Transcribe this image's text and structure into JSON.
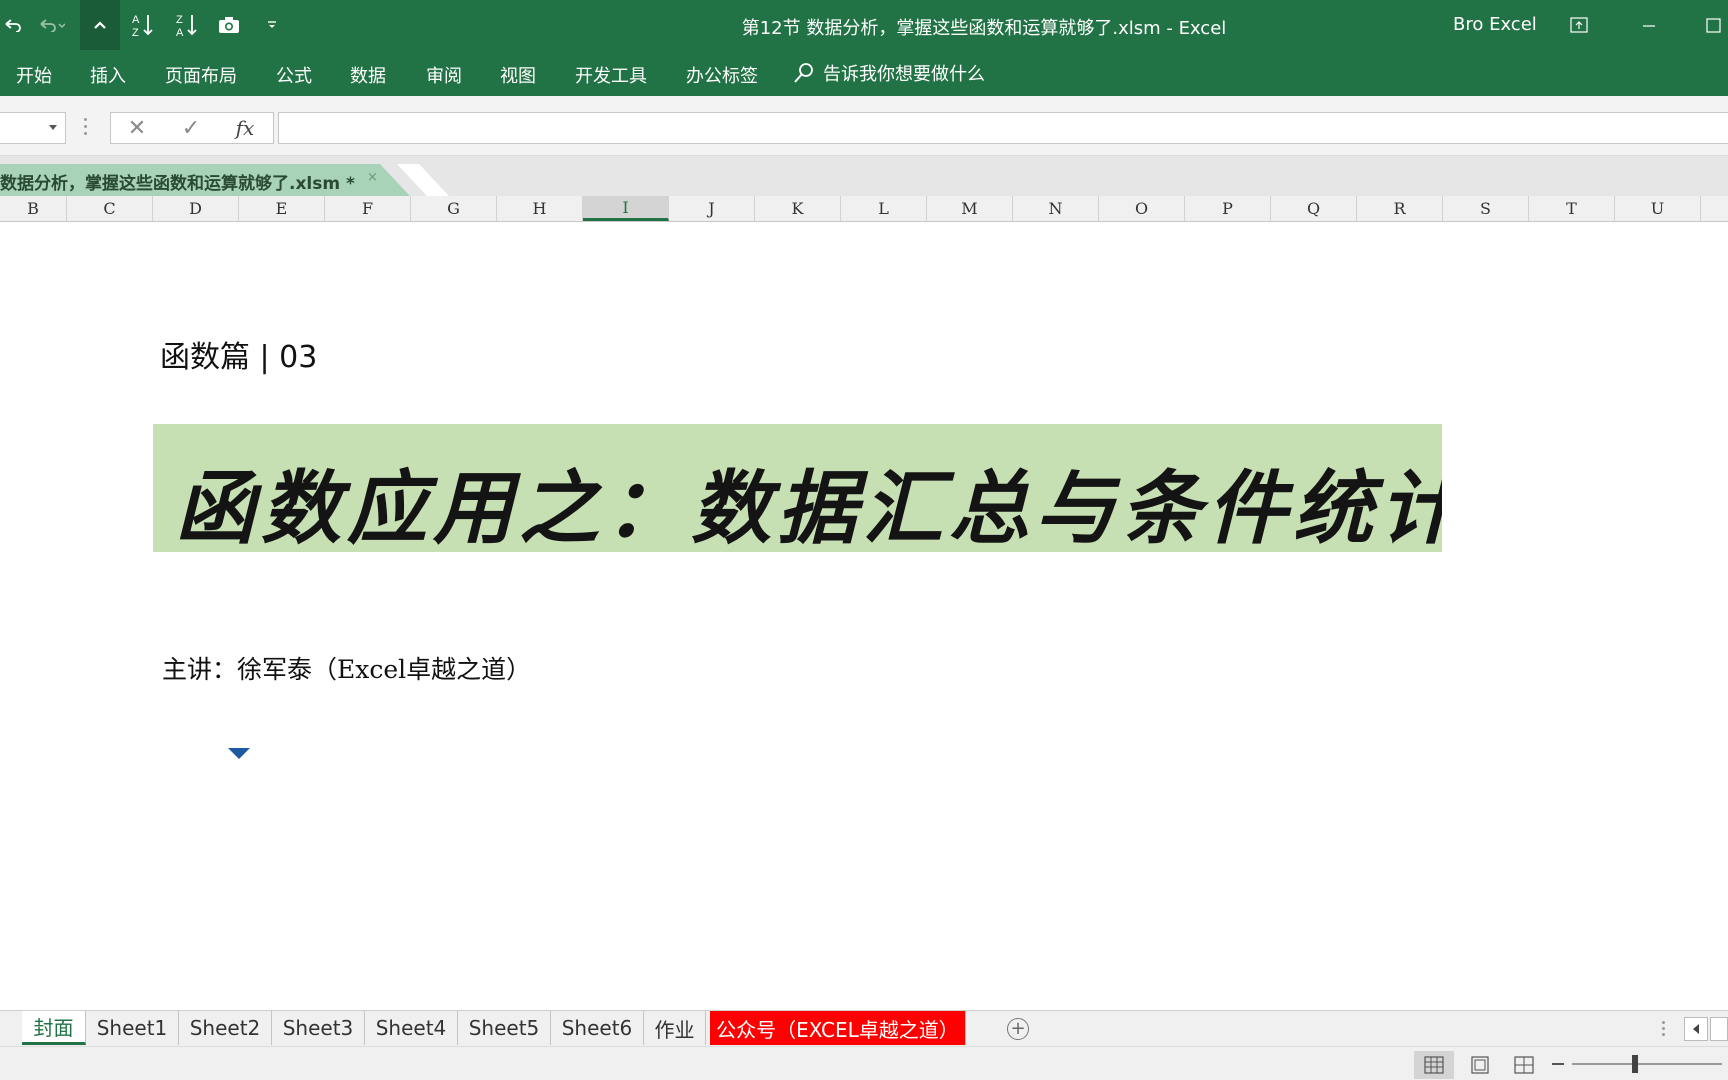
{
  "window": {
    "title": "第12节 数据分析，掌握这些函数和运算就够了.xlsm  -  Excel",
    "user": "Bro Excel"
  },
  "ribbon": {
    "tabs": [
      "开始",
      "插入",
      "页面布局",
      "公式",
      "数据",
      "审阅",
      "视图",
      "开发工具",
      "办公标签"
    ],
    "tell_me": "告诉我你想要做什么"
  },
  "formula_bar": {
    "name_box": "",
    "cancel": "✕",
    "enter": "✓",
    "fx": "fx",
    "content": ""
  },
  "workbook_tab": {
    "label": "数据分析，掌握这些函数和运算就够了.xlsm *",
    "close": "×"
  },
  "columns": [
    "B",
    "C",
    "D",
    "E",
    "F",
    "G",
    "H",
    "I",
    "J",
    "K",
    "L",
    "M",
    "N",
    "O",
    "P",
    "Q",
    "R",
    "S",
    "T",
    "U"
  ],
  "selected_column": "I",
  "sheet": {
    "subtitle": "函数篇 | 03",
    "banner": "函数应用之：数据汇总与条件统计",
    "banner_color": "#c6e0b4",
    "presenter": "主讲：徐军泰（Excel卓越之道）"
  },
  "sheet_tabs": [
    {
      "label": "封面",
      "active": true
    },
    {
      "label": "Sheet1"
    },
    {
      "label": "Sheet2"
    },
    {
      "label": "Sheet3"
    },
    {
      "label": "Sheet4"
    },
    {
      "label": "Sheet5"
    },
    {
      "label": "Sheet6"
    },
    {
      "label": "作业"
    },
    {
      "label": "公众号（EXCEL卓越之道）",
      "color": "#ff0000"
    }
  ],
  "colors": {
    "excel_green": "#217346",
    "accent_red": "#ff0000"
  }
}
